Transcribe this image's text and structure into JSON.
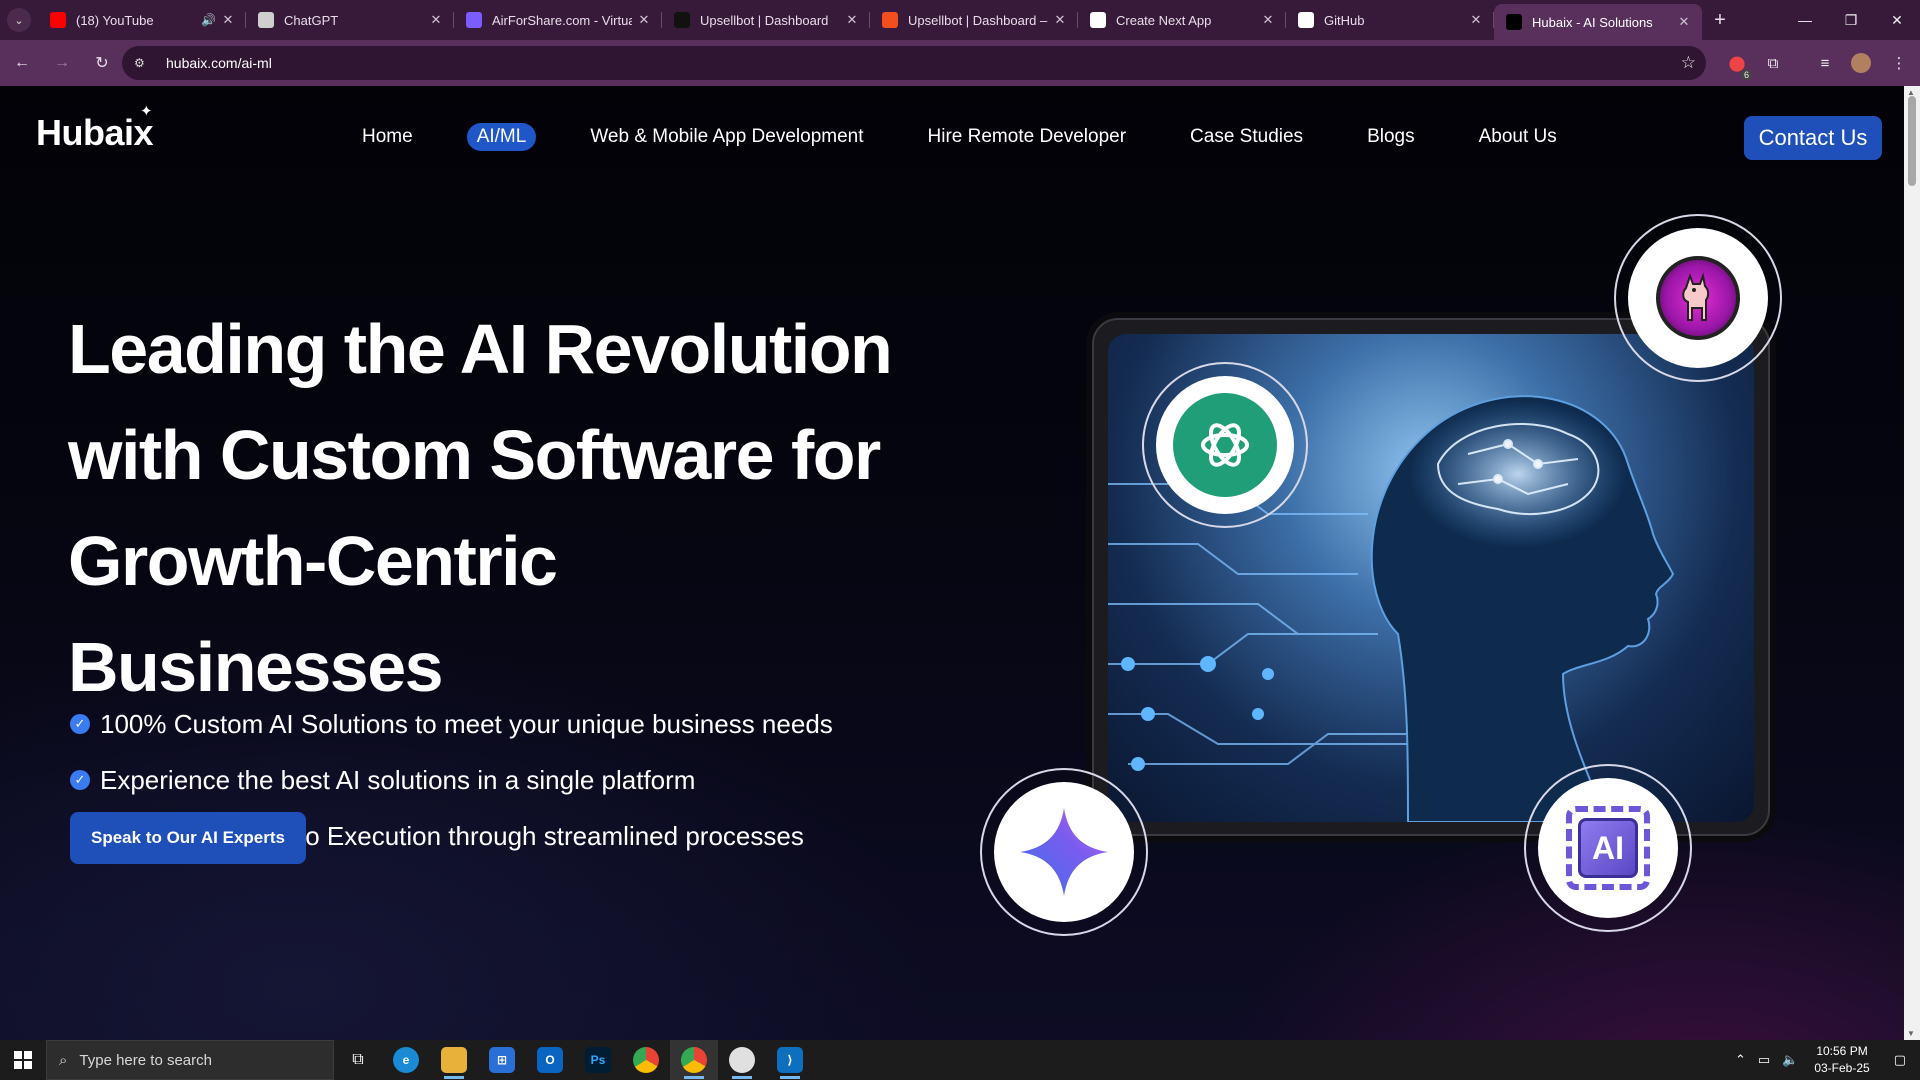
{
  "browser": {
    "tabs": [
      {
        "title": "(18) YouTube",
        "icon": "youtube-icon",
        "color": "#ff0000",
        "audio": true
      },
      {
        "title": "ChatGPT",
        "icon": "openai-icon",
        "color": "#cfcfcf"
      },
      {
        "title": "AirForShare.com - Virtual",
        "icon": "airforshare-icon",
        "color": "#7a5cff"
      },
      {
        "title": "Upsellbot | Dashboard",
        "icon": "play-icon",
        "color": "#111111"
      },
      {
        "title": "Upsellbot | Dashboard – F",
        "icon": "figma-icon",
        "color": "#f24e1e"
      },
      {
        "title": "Create Next App",
        "icon": "vercel-icon",
        "color": "#ffffff"
      },
      {
        "title": "GitHub",
        "icon": "github-icon",
        "color": "#ffffff"
      },
      {
        "title": "Hubaix - AI Solutions",
        "icon": "hubaix-icon",
        "color": "#000000",
        "active": true
      }
    ],
    "url": "hubaix.com/ai-ml",
    "extension_badge": "6"
  },
  "site": {
    "logo": "Hubaix",
    "nav": [
      {
        "label": "Home",
        "active": false
      },
      {
        "label": "AI/ML",
        "active": true
      },
      {
        "label": "Web & Mobile App Development",
        "active": false
      },
      {
        "label": "Hire Remote Developer",
        "active": false
      },
      {
        "label": "Case Studies",
        "active": false
      },
      {
        "label": "Blogs",
        "active": false
      },
      {
        "label": "About Us",
        "active": false
      }
    ],
    "contact_label": "Contact Us",
    "accent": "#1f4fb8"
  },
  "hero": {
    "title_lines": [
      "Leading the AI Revolution",
      "with Custom Software for",
      "Growth-Centric Businesses"
    ],
    "bullets": [
      "100% Custom AI Solutions to meet your unique business needs",
      "Experience the best AI solutions in a single platform",
      "60% Faster Idea to Execution through streamlined processes"
    ],
    "cta_label": "Speak to Our AI Experts",
    "badges": {
      "openai": "openai-logo-icon",
      "llama": "llama-icon",
      "gemini": "gemini-sparkle-icon",
      "ai_chip": "AI"
    }
  },
  "taskbar": {
    "search_placeholder": "Type here to search",
    "time": "10:56 PM",
    "date": "03-Feb-25"
  }
}
